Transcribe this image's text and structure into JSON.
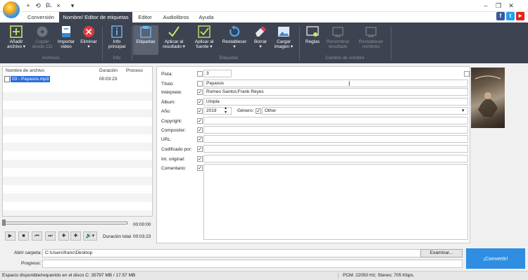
{
  "app": {
    "title_hint": ""
  },
  "qat": {
    "items": [
      "+",
      "⟲",
      "P̶",
      "×",
      "▾"
    ]
  },
  "tabs": [
    "Conversión",
    "Nombre/ Editor de etiquetas",
    "Editor",
    "Audiolibros",
    "Ayuda"
  ],
  "social": {
    "facebook": "f",
    "twitter": "t",
    "youtube": "▶"
  },
  "ribbon": {
    "buttons": [
      {
        "label": "Añadir\narchivo ▾",
        "icon": "add-file-icon",
        "disabled": false
      },
      {
        "label": "Copiar\ndesde CD",
        "icon": "cd-icon",
        "disabled": true
      },
      {
        "label": "Importar\nvideo",
        "icon": "import-video-icon",
        "disabled": false
      },
      {
        "label": "Eliminar\n▾",
        "icon": "delete-icon",
        "disabled": false
      },
      {
        "label": "Info\nprincipal",
        "icon": "info-icon",
        "disabled": false
      },
      {
        "label": "Etiquetas",
        "icon": "tags-icon",
        "disabled": false
      },
      {
        "label": "Aplicar al\nresultado ▾",
        "icon": "check-icon",
        "disabled": false
      },
      {
        "label": "Aplicar al\nfuente ▾",
        "icon": "check-box-icon",
        "disabled": false
      },
      {
        "label": "Restablecer\n▾",
        "icon": "reset-icon",
        "disabled": false
      },
      {
        "label": "Borrar\n▾",
        "icon": "eraser-icon",
        "disabled": false
      },
      {
        "label": "Cargar\nimagen ▾",
        "icon": "image-icon",
        "disabled": false
      },
      {
        "label": "Reglas",
        "icon": "rules-icon",
        "disabled": false
      },
      {
        "label": "Renombrar\nresultado",
        "icon": "rename-result-icon",
        "disabled": true
      },
      {
        "label": "Restablecer\nnombres",
        "icon": "reset-names-icon",
        "disabled": true
      }
    ],
    "groups": [
      "Archivos",
      "Info",
      "Etiquetas",
      "Cambio de nombre"
    ]
  },
  "filelist": {
    "columns": [
      "Nombre de archivo",
      "Duración",
      "Proceso"
    ],
    "rows": [
      {
        "name": "03 - Payasos.mp3",
        "duration": "00:03:23",
        "process": ""
      }
    ]
  },
  "player": {
    "position": "00:00:00",
    "total_label": "Duración total",
    "total": "00:03:23"
  },
  "tags": {
    "pista": {
      "label": "Pista:",
      "value": "3"
    },
    "titulo": {
      "label": "Título:",
      "value": "Payasos"
    },
    "interprete": {
      "label": "Intérprete:",
      "value": "Romeo Santos;Frank Reyes"
    },
    "album": {
      "label": "Álbum:",
      "value": "Utopia"
    },
    "anio": {
      "label": "Año:",
      "value": "2019"
    },
    "genero": {
      "label": "Género:",
      "value": "Other"
    },
    "copyright": {
      "label": "Copyright:",
      "value": ""
    },
    "compositor": {
      "label": "Compositor:",
      "value": ""
    },
    "url": {
      "label": "URL:",
      "value": ""
    },
    "codificado": {
      "label": "Codificado por:",
      "value": ""
    },
    "int_original": {
      "label": "Int. original:",
      "value": ""
    },
    "comentario": {
      "label": "Comentario:",
      "value": ""
    }
  },
  "bottom": {
    "folder_label": "Abrir carpeta:",
    "folder_value": "C:\\Users\\franc\\Desktop",
    "browse_label": "Examinar...",
    "progress_label": "Progreso:",
    "convert_label": "¡Convertir!"
  },
  "status": {
    "left": "Espacio disponible/requerido en el disco C: 35797 MB / 17.57 MB",
    "right": "PCM: 22050  Hz; Stereo; 705 Kbps."
  }
}
